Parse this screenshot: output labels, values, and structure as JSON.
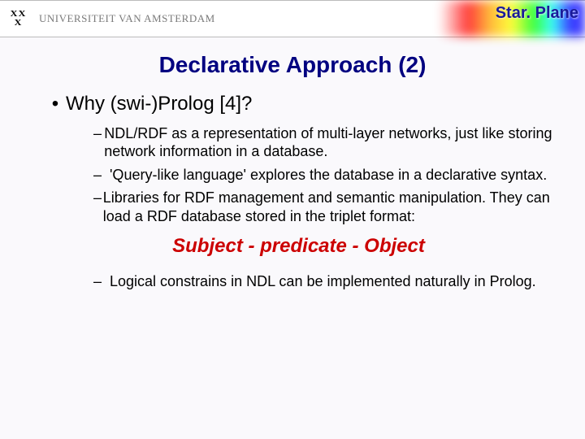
{
  "header": {
    "university": "UNIVERSITEIT VAN AMSTERDAM",
    "brand": "Star. Plane"
  },
  "title": "Declarative Approach (2)",
  "body": {
    "main_bullet": "Why (swi-)Prolog [4]?",
    "sub1": "NDL/RDF as a representation of multi-layer networks, just like storing network information in a database.",
    "sub2": "'Query-like language' explores the database in a declarative syntax.",
    "sub3": "Libraries for RDF management and semantic manipulation. They can load a RDF database stored in the triplet format:",
    "triplet": "Subject - predicate - Object",
    "sub4": "Logical constrains in NDL can be implemented naturally in Prolog."
  }
}
